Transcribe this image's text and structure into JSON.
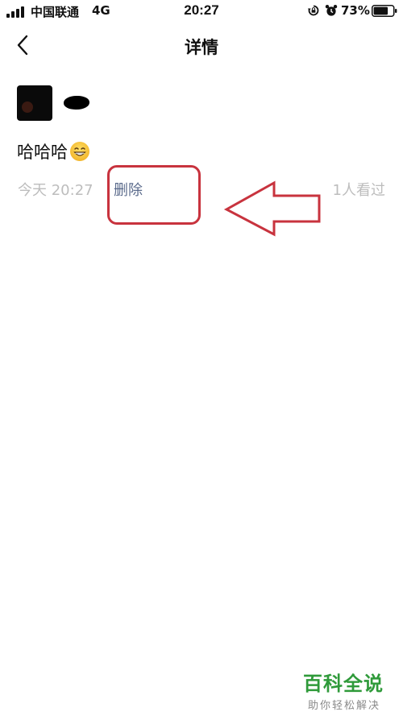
{
  "status_bar": {
    "carrier": "中国联通",
    "network": "4G",
    "time": "20:27",
    "battery": "73%"
  },
  "nav": {
    "title": "详情"
  },
  "post": {
    "text": "哈哈哈",
    "emoji": "smiling-face-emoji",
    "time": "今天 20:27",
    "delete_label": "删除",
    "viewed": "1人看过"
  },
  "watermark": {
    "title": "百科全说",
    "subtitle": "助你轻松解决"
  },
  "colors": {
    "annotation": "#c8333e",
    "link": "#5b6b8c",
    "meta": "#bdbdbd",
    "watermark": "#2f9a3a"
  }
}
